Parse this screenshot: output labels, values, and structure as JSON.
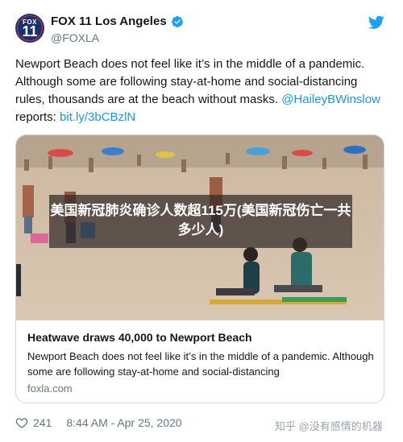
{
  "account": {
    "name": "FOX 11 Los Angeles",
    "handle": "@FOXLA",
    "avatar_top": "FOX",
    "avatar_num": "11",
    "verified_icon": "verified-badge-icon",
    "brand_color": "#1da1f2"
  },
  "tweet": {
    "text_part1": "Newport Beach does not feel like it’s in the middle of a pandemic. Although some are following stay-at-home and social-distancing rules, thousands are at the beach without masks. ",
    "mention": "@HaileyBWinslow",
    "text_part2": " reports: ",
    "link": "bit.ly/3bCBzlN"
  },
  "card": {
    "overlay_text": "美国新冠肺炎确诊人数超115万(美国新冠伤亡一共多少人)",
    "title": "Heatwave draws 40,000 to Newport Beach",
    "description": "Newport Beach does not feel like it’s in the middle of a pandemic. Although some are following stay-at-home and social-distancing",
    "domain": "foxla.com"
  },
  "footer": {
    "likes": "241",
    "timestamp": "8:44 AM - Apr 25, 2020",
    "watermark": "知乎 @没有感情的机器"
  }
}
